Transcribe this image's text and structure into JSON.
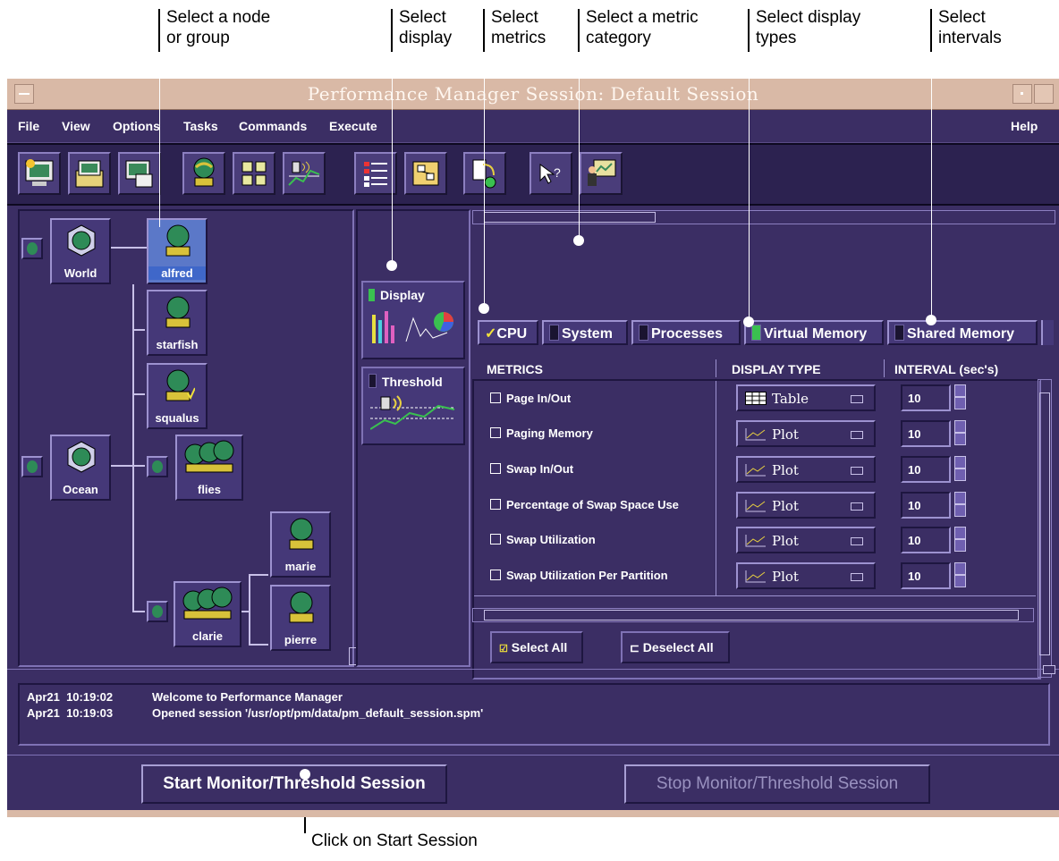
{
  "callouts": {
    "node": "Select a node\nor group",
    "display": "Select\ndisplay",
    "metrics": "Select\nmetrics",
    "category": "Select a metric\ncategory",
    "display_types": "Select display\ntypes",
    "intervals": "Select\nintervals",
    "start": "Click on Start Session"
  },
  "window": {
    "title": "Performance Manager Session: Default Session"
  },
  "menu": {
    "file": "File",
    "view": "View",
    "options": "Options",
    "tasks": "Tasks",
    "commands": "Commands",
    "execute": "Execute",
    "help": "Help"
  },
  "nodes": {
    "world": "World",
    "alfred": "alfred",
    "starfish": "starfish",
    "squalus": "squalus",
    "ocean": "Ocean",
    "flies": "flies",
    "marie": "marie",
    "clarie": "clarie",
    "pierre": "pierre"
  },
  "display_panel": {
    "display": "Display",
    "threshold": "Threshold"
  },
  "tabs": [
    "CPU",
    "System",
    "Processes",
    "Virtual Memory",
    "Shared Memory"
  ],
  "headers": {
    "metrics": "METRICS",
    "display_type": "DISPLAY TYPE",
    "interval": "INTERVAL (sec's)"
  },
  "metrics": [
    {
      "name": "Page In/Out",
      "display": "Table",
      "interval": "10"
    },
    {
      "name": "Paging Memory",
      "display": "Plot",
      "interval": "10"
    },
    {
      "name": "Swap In/Out",
      "display": "Plot",
      "interval": "10"
    },
    {
      "name": "Percentage of Swap Space Use",
      "display": "Plot",
      "interval": "10"
    },
    {
      "name": "Swap Utilization",
      "display": "Plot",
      "interval": "10"
    },
    {
      "name": "Swap Utilization Per Partition",
      "display": "Plot",
      "interval": "10"
    }
  ],
  "buttons": {
    "select_all": "Select All",
    "deselect_all": "Deselect All",
    "start": "Start Monitor/Threshold Session",
    "stop": "Stop Monitor/Threshold Session"
  },
  "log": [
    {
      "time": "Apr21  10:19:02",
      "msg": "Welcome to Performance Manager"
    },
    {
      "time": "Apr21  10:19:03",
      "msg": "Opened session '/usr/opt/pm/data/pm_default_session.spm'"
    }
  ],
  "colors": {
    "window_bg": "#3b2e64",
    "title_bg": "#d9b9a6",
    "selected_node": "#3f67c9",
    "check": "#f2e23a"
  }
}
